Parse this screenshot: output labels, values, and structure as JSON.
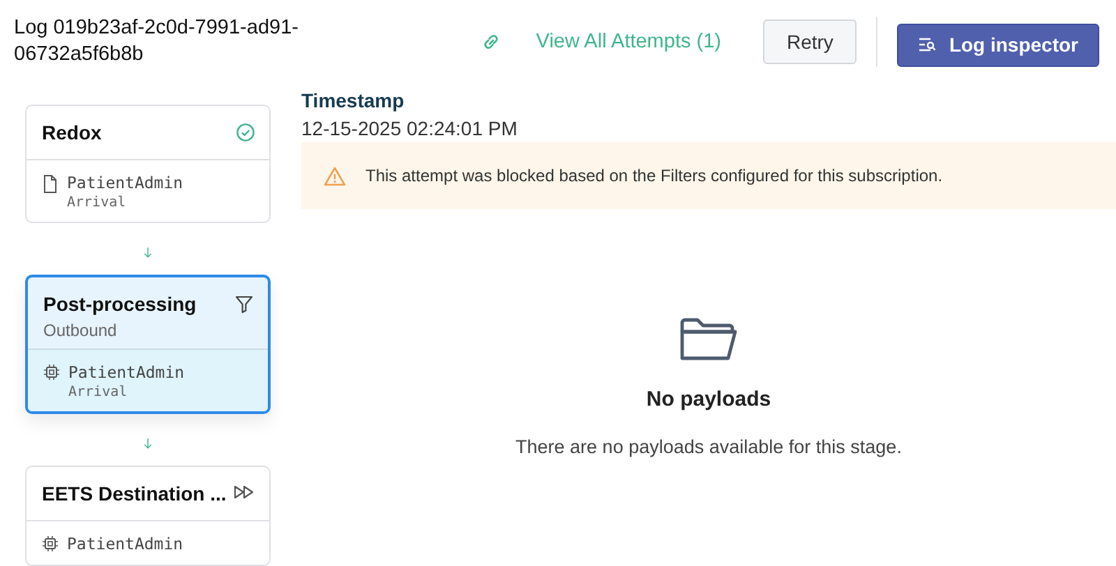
{
  "header": {
    "title": "Log 019b23af-2c0d-7991-ad91-06732a5f6b8b",
    "attempts_link": "View All Attempts (1)",
    "buttons": [
      {
        "label": "Retry",
        "kind": "secondary"
      },
      {
        "label": "Log inspector",
        "kind": "primary"
      }
    ]
  },
  "stages": [
    {
      "title": "Redox",
      "kind": "source",
      "selected": false,
      "message": {
        "kind": "file",
        "name": "PatientAdmin",
        "event": "Arrival"
      }
    },
    {
      "title": "Post-processing",
      "subtitle": "Outbound",
      "kind": "filter",
      "selected": true,
      "message": {
        "kind": "processed",
        "name": "PatientAdmin",
        "event": "Arrival"
      }
    },
    {
      "title": "EETS Destination ...",
      "kind": "destination",
      "selected": false,
      "message": {
        "kind": "processed",
        "name": "PatientAdmin"
      }
    }
  ],
  "details": {
    "timestamp_label": "Timestamp",
    "timestamp": "12-15-2025 02:24:01 PM",
    "alert": "This attempt was blocked based on the Filters configured for this subscription."
  },
  "empty_state": {
    "title": "No payloads",
    "text": "There are no payloads available for this stage."
  }
}
